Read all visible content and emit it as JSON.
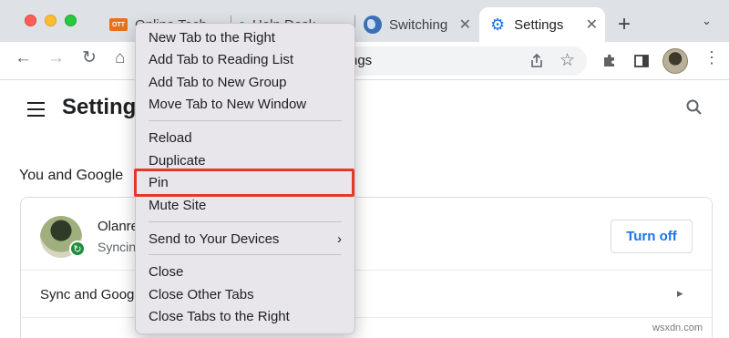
{
  "tabs": [
    {
      "label": "Online Tech",
      "favicon": "ott-logo-icon"
    },
    {
      "label": "Help Desk",
      "favicon": "green-dot-icon"
    },
    {
      "label": "Switching",
      "favicon": "globe-icon"
    },
    {
      "label": "Settings",
      "favicon": "gear-icon",
      "active": true
    }
  ],
  "toolbar": {
    "url": "ngs"
  },
  "settings": {
    "title": "Settings",
    "section_title": "You and Google",
    "account_name": "Olanre",
    "account_status": "Syncin",
    "turn_off_label": "Turn off",
    "sync_row_label": "Sync and Google"
  },
  "context_menu": {
    "groups": [
      [
        "New Tab to the Right",
        "Add Tab to Reading List",
        "Add Tab to New Group",
        "Move Tab to New Window"
      ],
      [
        "Reload",
        "Duplicate",
        "Pin",
        "Mute Site"
      ],
      [
        "Send to Your Devices"
      ],
      [
        "Close",
        "Close Other Tabs",
        "Close Tabs to the Right"
      ]
    ],
    "highlighted_item": "Pin"
  },
  "watermark": "wsxdn.com",
  "colors": {
    "accent": "#1a73e8",
    "highlight_border": "#e5382a",
    "menu_bg": "#e8e6ea",
    "tabstrip_bg": "#dee1e6"
  }
}
